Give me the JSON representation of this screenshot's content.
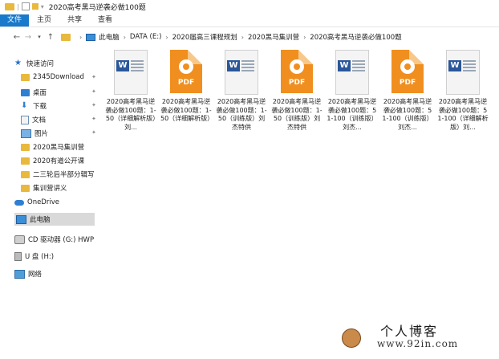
{
  "window": {
    "title": "2020高考黑马逆袭必做100题"
  },
  "ribbon": {
    "tabs": [
      "文件",
      "主页",
      "共享",
      "查看"
    ]
  },
  "address": {
    "breadcrumb": [
      "此电脑",
      "DATA (E:)",
      "2020届高三课程规划",
      "2020黑马集训营",
      "2020高考黑马逆袭必做100题"
    ]
  },
  "sidebar": {
    "items": [
      {
        "label": "快速访问",
        "icon": "star-icon"
      },
      {
        "label": "2345Download",
        "icon": "folder-icon",
        "pinned": true
      },
      {
        "label": "桌面",
        "icon": "desktop-icon",
        "pinned": true
      },
      {
        "label": "下载",
        "icon": "download-icon",
        "pinned": true
      },
      {
        "label": "文档",
        "icon": "document-icon",
        "pinned": true
      },
      {
        "label": "图片",
        "icon": "picture-icon",
        "pinned": true
      },
      {
        "label": "2020黑马集训营",
        "icon": "folder-icon"
      },
      {
        "label": "2020有道公开课",
        "icon": "folder-icon"
      },
      {
        "label": "二三轮后半部分辑写",
        "icon": "folder-icon"
      },
      {
        "label": "集训营讲义",
        "icon": "folder-icon"
      },
      {
        "label": "OneDrive",
        "icon": "cloud-icon"
      },
      {
        "label": "此电脑",
        "icon": "computer-icon",
        "selected": true
      },
      {
        "label": "CD 驱动器 (G:) HWP",
        "icon": "cd-drive-icon"
      },
      {
        "label": "U 盘 (H:)",
        "icon": "usb-drive-icon"
      },
      {
        "label": "网络",
        "icon": "network-icon"
      }
    ]
  },
  "files": [
    {
      "type": "word",
      "icon_label": "W",
      "name": "2020高考黑马逆袭必做100题：1-50（详细解析版）刘..."
    },
    {
      "type": "pdf",
      "icon_label": "PDF",
      "name": "2020高考黑马逆袭必做100题：1-50（详细解析版）"
    },
    {
      "type": "word",
      "icon_label": "W",
      "name": "2020高考黑马逆袭必做100题：1-50（训练版）刘杰特供"
    },
    {
      "type": "pdf",
      "icon_label": "PDF",
      "name": "2020高考黑马逆袭必做100题：1-50（训练版）刘杰特供"
    },
    {
      "type": "word",
      "icon_label": "W",
      "name": "2020高考黑马逆袭必做100题：51-100（训练版）刘杰..."
    },
    {
      "type": "pdf",
      "icon_label": "PDF",
      "name": "2020高考黑马逆袭必做100题：51-100（训练版）刘杰..."
    },
    {
      "type": "word",
      "icon_label": "W",
      "name": "2020高考黑马逆袭必做100题：51-100（详细解析版）刘..."
    }
  ],
  "watermark": {
    "title": "个人博客",
    "url": "www.92in.com"
  },
  "colors": {
    "accent": "#1979ca",
    "pdf": "#f08f1f",
    "word": "#2b579a",
    "folder": "#e8b93d"
  }
}
